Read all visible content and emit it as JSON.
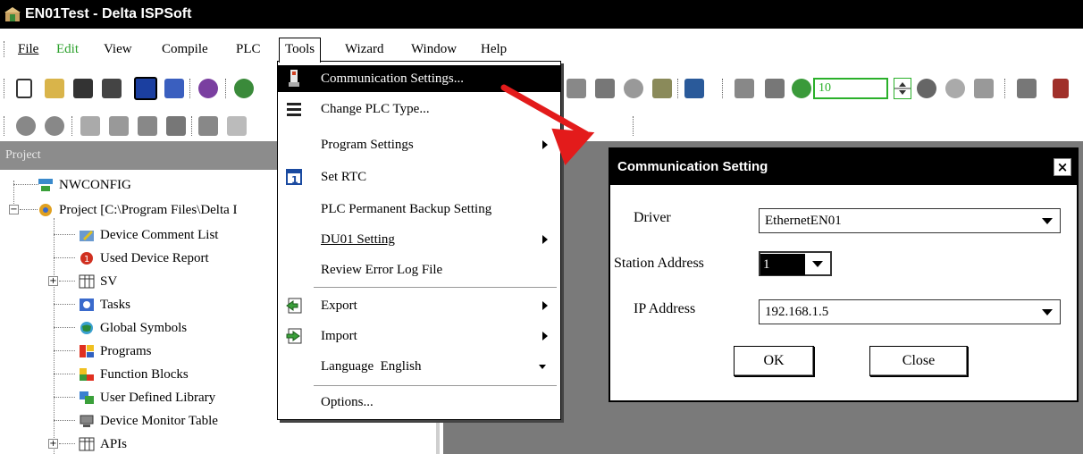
{
  "window": {
    "title": "EN01Test - Delta ISPSoft"
  },
  "menu": {
    "items": [
      "File",
      "Edit",
      "View",
      "Compile",
      "PLC",
      "Tools",
      "Wizard",
      "Window",
      "Help"
    ]
  },
  "toolbar": {
    "zoom_value": "10"
  },
  "project_panel": {
    "header": "Project",
    "tree": [
      "NWCONFIG",
      "Project [C:\\Program Files\\Delta I",
      "Device Comment List",
      "Used Device Report",
      "SV",
      "Tasks",
      "Global Symbols",
      "Programs",
      "Function Blocks",
      "User Defined Library",
      "Device Monitor Table",
      "APIs"
    ]
  },
  "tools_menu": {
    "items": [
      "Communication Settings...",
      "Change PLC Type...",
      "Program Settings",
      "Set RTC",
      "PLC Permanent Backup Setting",
      "DU01 Setting",
      "Review Error Log File",
      "Export",
      "Import",
      "Language  English",
      "Options..."
    ]
  },
  "dialog": {
    "title": "Communication Setting",
    "close_glyph": "×",
    "driver_label": "Driver",
    "driver_value": "EthernetEN01",
    "station_label": "Station Address",
    "station_value": "1",
    "ip_label": "IP Address",
    "ip_value": "192.168.1.5",
    "ok_label": "OK",
    "close_label": "Close"
  },
  "colors": {
    "annotation_arrow": "#e31b1b",
    "highlight": "#000000",
    "panel_gray": "#7a7a7a"
  }
}
